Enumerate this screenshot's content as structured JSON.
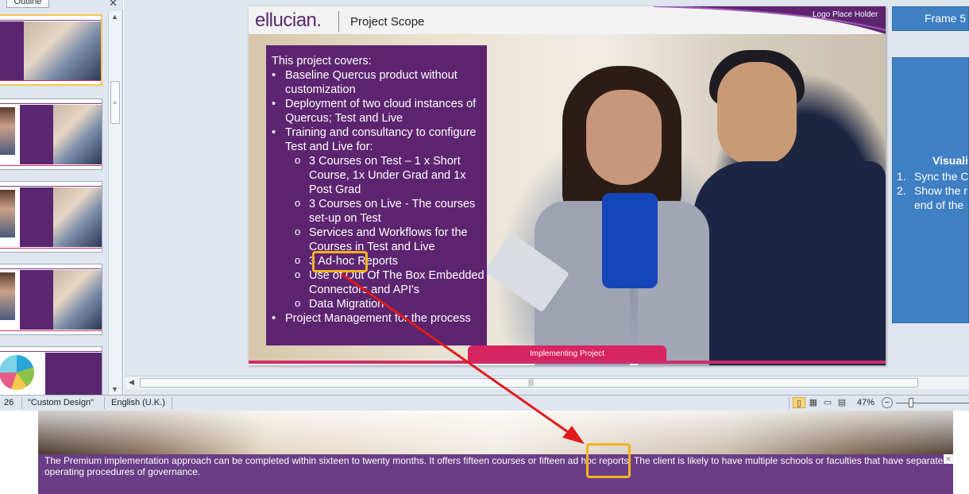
{
  "outline_panel": {
    "tab_label": "Outline",
    "close_glyph": "✕",
    "scroll_up_glyph": "▲",
    "scroll_down_glyph": "▼",
    "scroll_grip_glyph": "≡"
  },
  "slide": {
    "logo": "ellucian.",
    "title": "Project Scope",
    "logo_placeholder": "Logo Place Holder",
    "intro": "This project covers:",
    "bullets": [
      "Baseline Quercus product without customization",
      "Deployment of two cloud instances of Quercus; Test and Live",
      "Training and consultancy to configure Test and Live for:"
    ],
    "sub_bullets": [
      "3 Courses on Test – 1 x Short Course, 1x Under Grad and 1x Post Grad",
      "3 Courses on Live - The courses set-up on Test",
      "Services and Workflows for the Courses in Test and Live",
      "3 Ad-hoc Reports",
      "Use of Out Of The Box Embedded Connectors and API's",
      "Data Migration"
    ],
    "last_bullet": "Project Management for the process",
    "footer_tab": "Implementing Project"
  },
  "right_frame": {
    "label": "Frame 5",
    "title": "Visuali",
    "item1_num": "1.",
    "item1_text": "Sync the C",
    "item2_num": "2.",
    "item2_text": "Show the r",
    "item2_cont": "end of the"
  },
  "hscroll": {
    "left_glyph": "◀",
    "grip_glyph": "|||"
  },
  "statusbar": {
    "slide_count": "26",
    "theme": "\"Custom Design\"",
    "language": "English (U.K.)",
    "zoom": "47%",
    "zoom_minus": "−"
  },
  "caption": {
    "text": "The Premium implementation approach can be completed within sixteen to twenty months. It offers fifteen courses or fifteen ad hoc reports. The client is likely to have multiple schools or faculties that have separate operating procedures of governance.",
    "close_glyph": "✕"
  },
  "colors": {
    "brand_purple": "#5d2470",
    "accent_pink": "#d7235f",
    "frame_blue": "#3f7fc4",
    "highlight": "#f2b31c",
    "arrow_red": "#e01b1b"
  }
}
